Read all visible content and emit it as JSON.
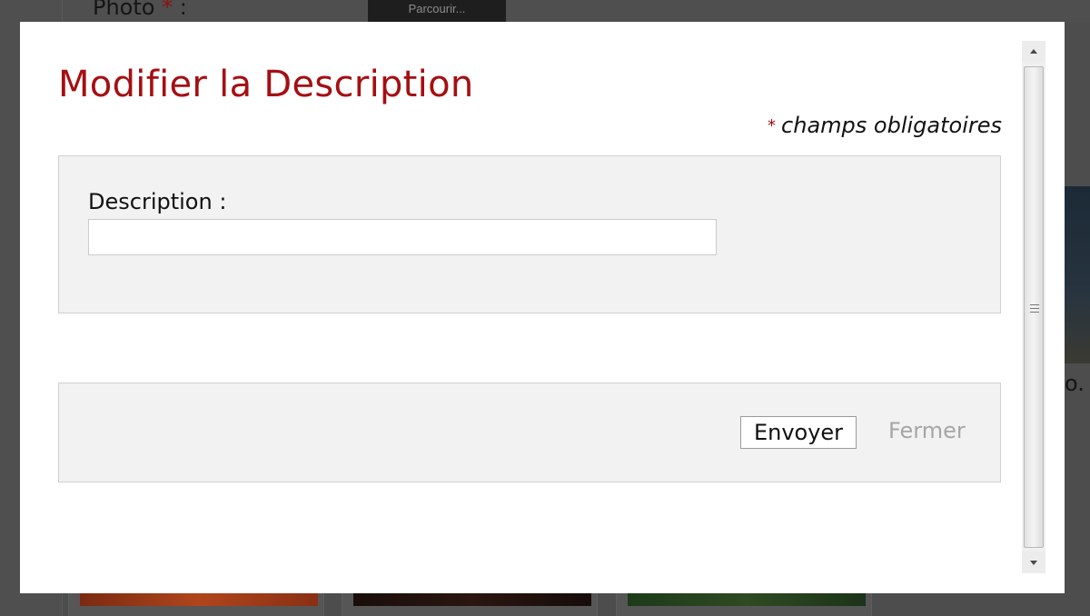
{
  "background": {
    "photo_label": "Photo",
    "photo_required_star": "*",
    "photo_label_suffix": " :",
    "browse_button_label": "Parcourir...",
    "right_text": "o."
  },
  "modal": {
    "title": "Modifier la Description",
    "required_star": "*",
    "required_note": "champs obligatoires",
    "description_label": "Description :",
    "description_value": "",
    "send_label": "Envoyer",
    "close_label": "Fermer"
  },
  "colors": {
    "title_red": "#a50f12",
    "panel_gray": "#f2f2f2",
    "overlay": "#4d4d4d"
  }
}
